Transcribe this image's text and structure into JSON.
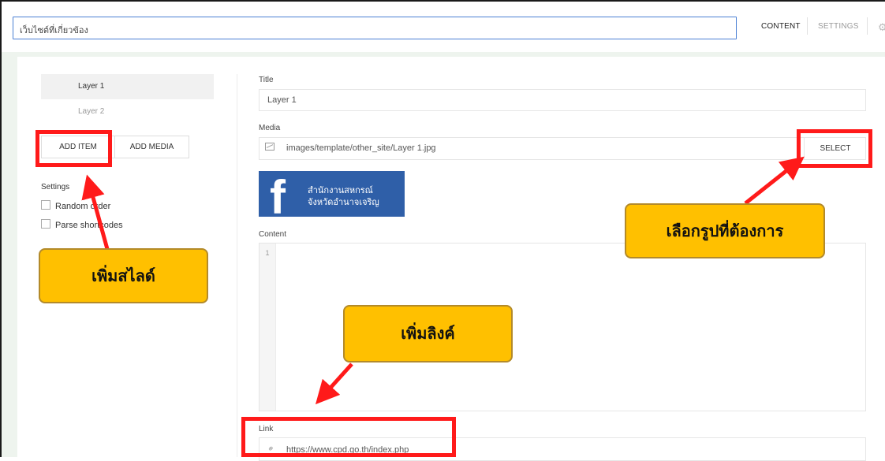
{
  "header": {
    "title_value": "เว็บไซต์ที่เกี่ยวข้อง",
    "tab_content": "CONTENT",
    "tab_settings": "SETTINGS"
  },
  "sidebar": {
    "layers": [
      "Layer 1",
      "Layer 2"
    ],
    "add_item_label": "ADD ITEM",
    "add_media_label": "ADD MEDIA",
    "settings_label": "Settings",
    "options": [
      {
        "label": "Random order",
        "checked": false
      },
      {
        "label": "Parse shortcodes",
        "checked": false
      }
    ]
  },
  "form": {
    "title_label": "Title",
    "title_value": "Layer 1",
    "media_label": "Media",
    "media_value": "images/template/other_site/Layer 1.jpg",
    "select_label": "SELECT",
    "thumbnail": {
      "line1": "สำนักงานสหกรณ์",
      "line2": "จังหวัดอำนาจเจริญ",
      "icon": "facebook-f"
    },
    "content_label": "Content",
    "line_number": "1",
    "link_label": "Link",
    "link_value": "https://www.cpd.go.th/index.php"
  },
  "annotations": {
    "add_slide": "เพิ่มสไลด์",
    "choose_image": "เลือกรูปที่ต้องการ",
    "add_link": "เพิ่มลิงค์"
  },
  "colors": {
    "highlight": "#ff1a1a",
    "callout": "#ffc000",
    "accent": "#4a7fd4",
    "facebook": "#2f5fa8"
  }
}
